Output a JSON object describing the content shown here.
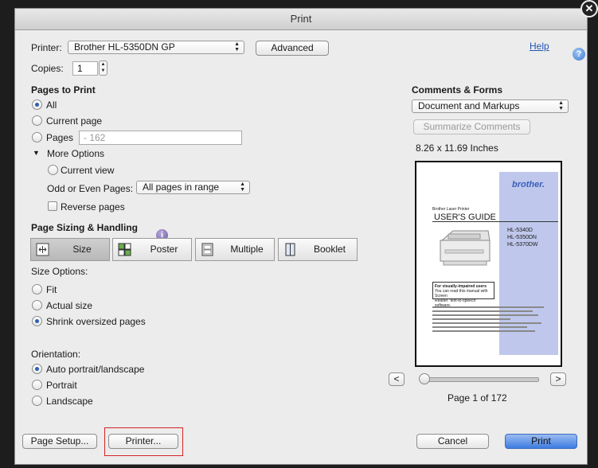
{
  "window": {
    "title": "Print"
  },
  "printer": {
    "label": "Printer:",
    "value": "Brother HL-5350DN GP",
    "advanced_button": "Advanced",
    "help_link": "Help",
    "help_icon": "?"
  },
  "copies": {
    "label": "Copies:",
    "value": "1"
  },
  "pages_to_print": {
    "heading": "Pages to Print",
    "options": [
      "All",
      "Current page",
      "Pages"
    ],
    "pages_placeholder": "- 162",
    "more_options": "More Options",
    "current_view": "Current view",
    "odd_even_label": "Odd or Even Pages:",
    "odd_even_value": "All pages in range",
    "reverse_pages": "Reverse pages"
  },
  "page_sizing": {
    "heading": "Page Sizing & Handling",
    "info_icon": "i",
    "modes": [
      "Size",
      "Poster",
      "Multiple",
      "Booklet"
    ],
    "size_options_label": "Size Options:",
    "size_options": [
      "Fit",
      "Actual size",
      "Shrink oversized pages"
    ]
  },
  "orientation": {
    "label": "Orientation:",
    "options": [
      "Auto portrait/landscape",
      "Portrait",
      "Landscape"
    ]
  },
  "comments_forms": {
    "heading": "Comments & Forms",
    "value": "Document and Markups",
    "summarize_button": "Summarize Comments"
  },
  "preview": {
    "page_size": "8.26 x 11.69 Inches",
    "page_status": "Page 1 of 172",
    "prev": "<",
    "next": ">",
    "slider_fraction": 0,
    "doc": {
      "brand": "brother.",
      "kicker": "Brother Laser Printer",
      "title": "USER'S GUIDE",
      "models": [
        "HL-5340D",
        "HL-5350DN",
        "HL-5370DW"
      ],
      "notice_title": "For visually-impaired users",
      "notice_body": [
        "You can read this manual with Screen",
        "Reader \"text-to-speech\" software."
      ]
    }
  },
  "footer": {
    "page_setup": "Page Setup...",
    "printer": "Printer...",
    "cancel": "Cancel",
    "print": "Print"
  },
  "colors": {
    "accent": "#3d7ce0",
    "highlight_box": "#d32424",
    "preview_band": "#bfc8ec"
  }
}
